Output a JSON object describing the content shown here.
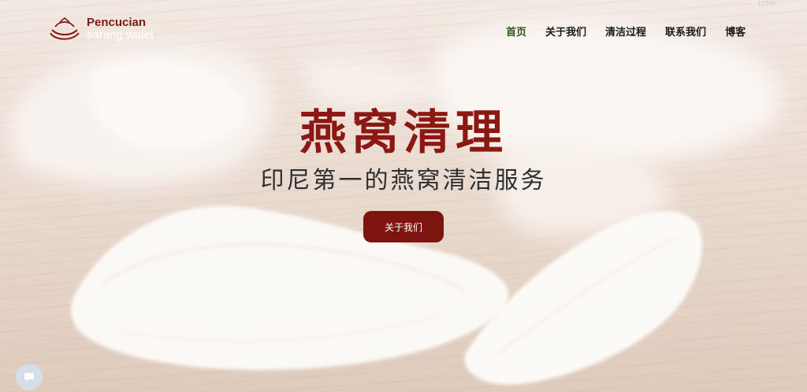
{
  "logo": {
    "line1": "Pencucian",
    "line2": "sarang walet"
  },
  "corner_mark": "123RF",
  "nav": {
    "items": [
      {
        "label": "首页",
        "active": true
      },
      {
        "label": "关于我们",
        "active": false
      },
      {
        "label": "清洁过程",
        "active": false
      },
      {
        "label": "联系我们",
        "active": false
      },
      {
        "label": "博客",
        "active": false
      }
    ]
  },
  "hero": {
    "title": "燕窝清理",
    "subtitle": "印尼第一的燕窝清洁服务",
    "cta_label": "关于我们"
  },
  "colors": {
    "brand_red": "#7e140f",
    "title_red": "#8b1812",
    "nav_active": "#2f5a1a"
  },
  "icons": {
    "logo": "bird-nest-logo-icon",
    "chat": "chat-icon"
  }
}
